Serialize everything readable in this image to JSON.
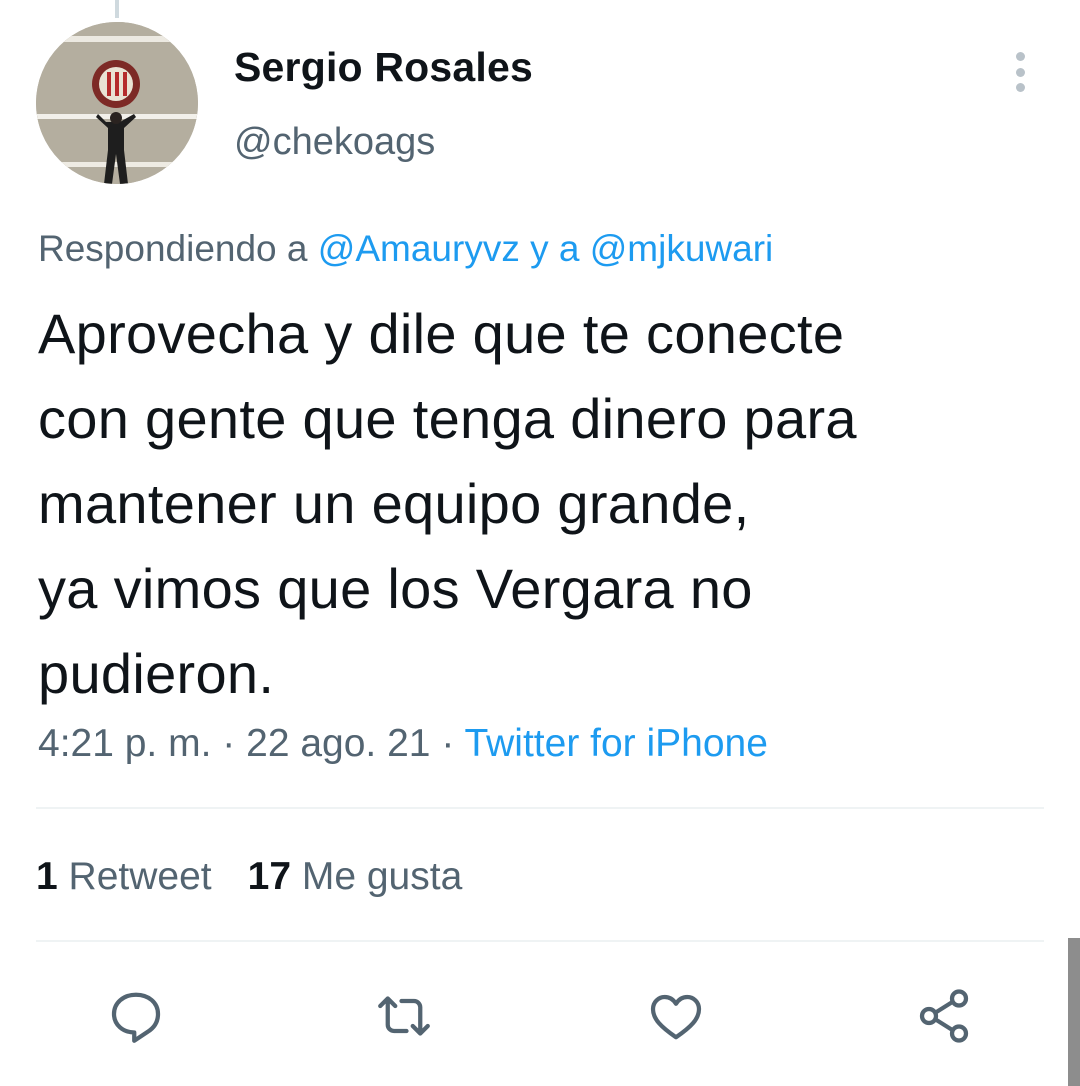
{
  "author": {
    "name": "Sergio Rosales",
    "handle": "@chekoags"
  },
  "reply_context": {
    "prefix": "Respondiendo a",
    "mention1": "@Amauryvz",
    "connector": "y a",
    "mention2": "@mjkuwari"
  },
  "tweet": {
    "lines": [
      "Aprovecha y dile que te conecte",
      "con gente que tenga dinero para",
      "mantener un equipo grande,",
      "ya vimos que los Vergara no",
      "pudieron."
    ]
  },
  "meta": {
    "time": "4:21 p. m.",
    "separator": "·",
    "date": "22 ago. 21",
    "source": "Twitter for iPhone"
  },
  "stats": {
    "retweet_count": "1",
    "retweet_label": "Retweet",
    "like_count": "17",
    "like_label": "Me gusta"
  },
  "icons": {
    "reply": "reply-icon",
    "retweet": "retweet-icon",
    "like": "heart-icon",
    "share": "share-icon",
    "more": "more-options-icon"
  },
  "colors": {
    "link": "#1d9bf0",
    "secondary_text": "#536471",
    "primary_text": "#0f1419",
    "icon": "#536471"
  }
}
